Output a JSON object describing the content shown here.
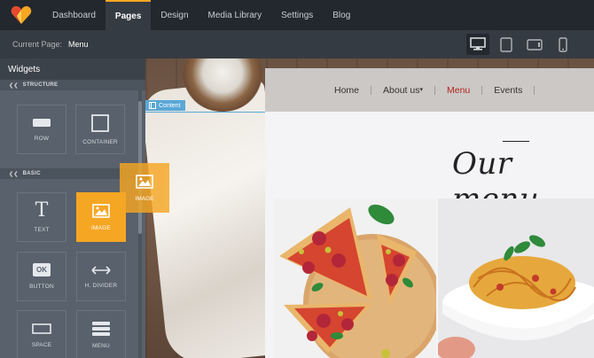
{
  "topnav": {
    "items": [
      {
        "label": "Dashboard",
        "active": false
      },
      {
        "label": "Pages",
        "active": true
      },
      {
        "label": "Design",
        "active": false
      },
      {
        "label": "Media Library",
        "active": false
      },
      {
        "label": "Settings",
        "active": false
      },
      {
        "label": "Blog",
        "active": false
      }
    ]
  },
  "subbar": {
    "current_page_label": "Current Page:",
    "current_page_value": "Menu",
    "devices": [
      "desktop-icon",
      "tablet-portrait-icon",
      "tablet-landscape-icon",
      "mobile-icon"
    ],
    "active_device": "desktop-icon"
  },
  "sidebar": {
    "title": "Widgets",
    "sections": [
      {
        "label": "STRUCTURE",
        "widgets": [
          "ROW",
          "CONTAINER"
        ]
      },
      {
        "label": "BASIC",
        "widgets": [
          "TEXT",
          "IMAGE",
          "BUTTON",
          "H. DIVIDER",
          "SPACE",
          "MENU"
        ]
      }
    ],
    "active_widget": "IMAGE"
  },
  "drag": {
    "label": "IMAGE"
  },
  "canvas": {
    "content_tag": "Content"
  },
  "site": {
    "nav": [
      {
        "label": "Home",
        "active": false
      },
      {
        "label": "About us",
        "dropdown": true,
        "active": false
      },
      {
        "label": "Menu",
        "active": true
      },
      {
        "label": "Events",
        "active": false
      }
    ],
    "title": "Our menu"
  },
  "colors": {
    "accent": "#f5a623",
    "nav_active": "#b3261e",
    "selection": "#5aa7d6"
  }
}
